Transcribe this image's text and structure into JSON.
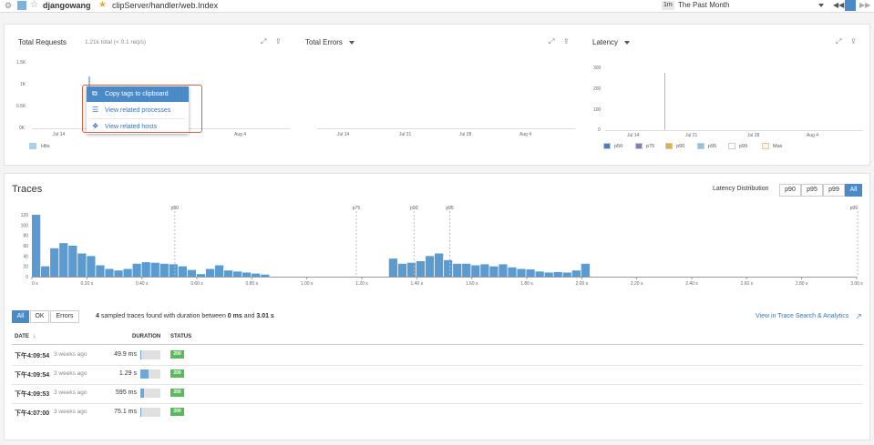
{
  "header": {
    "service": "djangowang",
    "resource": "clipServer/handler/web.Index",
    "time_badge": "1m",
    "time_range": "The Past Month"
  },
  "widgets": {
    "requests": {
      "title": "Total Requests",
      "subtitle": "1.21k total (< 0.1 req/s)",
      "y_ticks": [
        "1.5K",
        "1K",
        "0.5K",
        "0K"
      ],
      "x_ticks": [
        "Jul 14",
        "Jul 21",
        "Jul 28",
        "Aug 4"
      ],
      "legend": [
        "Hits"
      ]
    },
    "errors": {
      "title": "Total Errors",
      "x_ticks": [
        "Jul 14",
        "Jul 21",
        "Jul 28",
        "Aug 4"
      ]
    },
    "latency": {
      "title": "Latency",
      "y_ticks": [
        "300",
        "200",
        "100",
        "0"
      ],
      "x_ticks": [
        "Jul 14",
        "Jul 21",
        "Jul 28",
        "Aug 4"
      ],
      "legend": [
        {
          "label": "p50",
          "color": "#4a80c0"
        },
        {
          "label": "p75",
          "color": "#8b7ab8"
        },
        {
          "label": "p90",
          "color": "#e0b040"
        },
        {
          "label": "p95",
          "color": "#8ec3e8"
        },
        {
          "label": "p99",
          "color": "#ffffff"
        },
        {
          "label": "Max",
          "color": "#fff4d0"
        }
      ]
    }
  },
  "context_menu": {
    "items": [
      "Copy tags to clipboard",
      "View related processes",
      "View related hosts"
    ]
  },
  "traces": {
    "title": "Traces",
    "dist_label": "Latency Distribution",
    "dist_buttons": [
      "p90",
      "p95",
      "p99",
      "All"
    ],
    "filter_buttons": [
      "All",
      "OK",
      "Errors"
    ],
    "summary_count": "4",
    "summary_text": "sampled traces found with duration between",
    "summary_min": "0 ms",
    "summary_and": "and",
    "summary_max": "3.01 s",
    "search_link": "View in Trace Search & Analytics",
    "columns": {
      "date": "DATE",
      "duration": "DURATION",
      "status": "STATUS"
    },
    "rows": [
      {
        "time": "下午4:09:54",
        "ago": "3 weeks ago",
        "duration": "49.9 ms",
        "fill": 0.02,
        "status": "200"
      },
      {
        "time": "下午4:09:54",
        "ago": "3 weeks ago",
        "duration": "1.29 s",
        "fill": 0.43,
        "status": "200"
      },
      {
        "time": "下午4:09:53",
        "ago": "3 weeks ago",
        "duration": "595 ms",
        "fill": 0.2,
        "status": "200"
      },
      {
        "time": "下午4:07:00",
        "ago": "3 weeks ago",
        "duration": "75.1 ms",
        "fill": 0.03,
        "status": "200"
      }
    ]
  },
  "chart_data": {
    "type": "bar",
    "y_ticks": [
      "120",
      "100",
      "80",
      "60",
      "40",
      "20",
      "0"
    ],
    "ylim": [
      0,
      120
    ],
    "x_ticks": [
      "0 s",
      "0.20 s",
      "0.40 s",
      "0.60 s",
      "0.80 s",
      "1.00 s",
      "1.20 s",
      "1.40 s",
      "1.60 s",
      "1.80 s",
      "2.00 s",
      "2.20 s",
      "2.40 s",
      "2.60 s",
      "2.80 s",
      "3.00 s"
    ],
    "xlim": [
      0,
      3.0
    ],
    "bin_width": 0.0333,
    "percentile_markers": [
      {
        "label": "p50",
        "x": 0.52
      },
      {
        "label": "p75",
        "x": 1.18
      },
      {
        "label": "p90",
        "x": 1.39
      },
      {
        "label": "p95",
        "x": 1.52
      },
      {
        "label": "p99",
        "x": 3.01
      }
    ],
    "values": [
      120,
      20,
      55,
      65,
      60,
      45,
      40,
      22,
      15,
      12,
      15,
      25,
      28,
      27,
      25,
      24,
      20,
      13,
      5,
      15,
      22,
      12,
      10,
      8,
      6,
      4,
      0,
      0,
      0,
      0,
      0,
      0,
      0,
      0,
      0,
      0,
      0,
      0,
      0,
      35,
      25,
      27,
      30,
      40,
      45,
      32,
      25,
      25,
      22,
      24,
      20,
      24,
      18,
      15,
      14,
      10,
      8,
      9,
      8,
      12,
      25
    ]
  }
}
